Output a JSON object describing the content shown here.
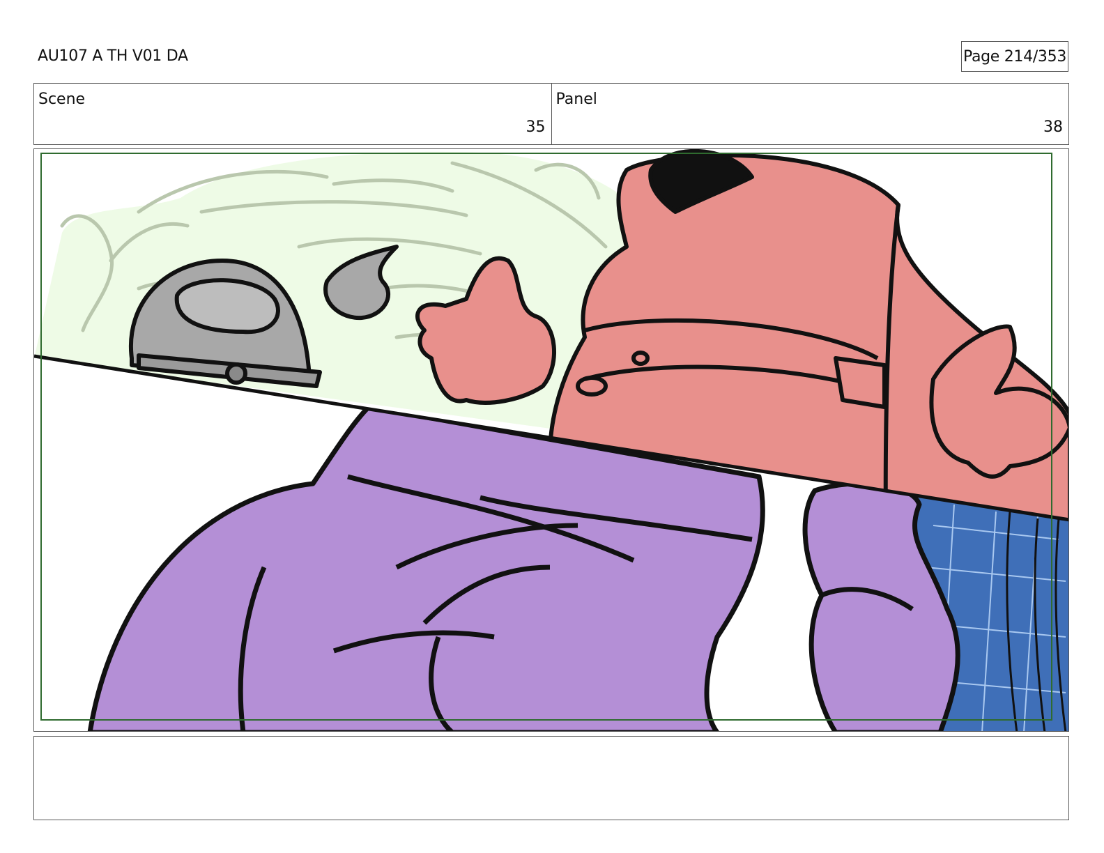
{
  "document": {
    "title": "AU107 A TH V01 DA",
    "page_label": "Page 214/353"
  },
  "scene": {
    "label": "Scene",
    "value": "35"
  },
  "panel": {
    "label": "Panel",
    "value": "38"
  },
  "artwork": {
    "colors": {
      "sketch_bg": "#eefbe6",
      "sketch_line": "#b9c7ad",
      "pink_character": "#e8908c",
      "purple_character": "#b48fd6",
      "gray_character": "#a8a8a8",
      "blue_screen": "#3f6fb8",
      "safe_frame": "#2f6b2f"
    }
  },
  "notes": {
    "text": ""
  }
}
